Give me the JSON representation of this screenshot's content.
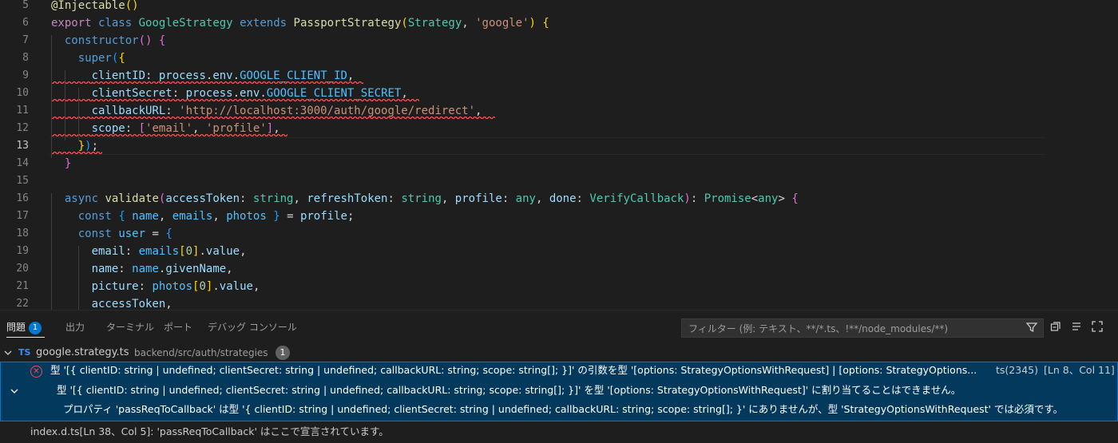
{
  "editor": {
    "lines": [
      {
        "n": "5",
        "t": [
          [
            "fn",
            "@Injectable"
          ],
          [
            "b1",
            "()"
          ]
        ]
      },
      {
        "n": "6",
        "t": [
          [
            "ctl",
            "export"
          ],
          [
            "p",
            " "
          ],
          [
            "kw",
            "class"
          ],
          [
            "p",
            " "
          ],
          [
            "cls",
            "GoogleStrategy"
          ],
          [
            "p",
            " "
          ],
          [
            "kw",
            "extends"
          ],
          [
            "p",
            " "
          ],
          [
            "fn",
            "PassportStrategy"
          ],
          [
            "b1",
            "("
          ],
          [
            "cls",
            "Strategy"
          ],
          [
            "p",
            ", "
          ],
          [
            "str",
            "'google'"
          ],
          [
            "b1",
            ")"
          ],
          [
            "p",
            " "
          ],
          [
            "b1",
            "{"
          ]
        ]
      },
      {
        "n": "7",
        "t": [
          [
            "p",
            "  "
          ],
          [
            "kw",
            "constructor"
          ],
          [
            "b2",
            "()"
          ],
          [
            "p",
            " "
          ],
          [
            "b2",
            "{"
          ]
        ]
      },
      {
        "n": "8",
        "t": [
          [
            "p",
            "    "
          ],
          [
            "kw",
            "super"
          ],
          [
            "b3",
            "("
          ],
          [
            "b1",
            "{"
          ]
        ]
      },
      {
        "n": "9",
        "t": [
          [
            "p",
            "      "
          ],
          [
            "var",
            "clientID"
          ],
          [
            "p",
            ": "
          ],
          [
            "var",
            "process"
          ],
          [
            "p",
            "."
          ],
          [
            "var",
            "env"
          ],
          [
            "p",
            "."
          ],
          [
            "const",
            "GOOGLE_CLIENT_ID"
          ],
          [
            "p",
            ","
          ]
        ]
      },
      {
        "n": "10",
        "t": [
          [
            "p",
            "      "
          ],
          [
            "var",
            "clientSecret"
          ],
          [
            "p",
            ": "
          ],
          [
            "var",
            "process"
          ],
          [
            "p",
            "."
          ],
          [
            "var",
            "env"
          ],
          [
            "p",
            "."
          ],
          [
            "const",
            "GOOGLE_CLIENT_SECRET"
          ],
          [
            "p",
            ","
          ]
        ]
      },
      {
        "n": "11",
        "t": [
          [
            "p",
            "      "
          ],
          [
            "var",
            "callbackURL"
          ],
          [
            "p",
            ": "
          ],
          [
            "str",
            "'http://localhost:3000/auth/google/redirect'"
          ],
          [
            "p",
            ","
          ]
        ]
      },
      {
        "n": "12",
        "t": [
          [
            "p",
            "      "
          ],
          [
            "var",
            "scope"
          ],
          [
            "p",
            ": "
          ],
          [
            "b2",
            "["
          ],
          [
            "str",
            "'email'"
          ],
          [
            "p",
            ", "
          ],
          [
            "str",
            "'profile'"
          ],
          [
            "b2",
            "]"
          ],
          [
            "p",
            ","
          ]
        ]
      },
      {
        "n": "13",
        "t": [
          [
            "p",
            "    "
          ],
          [
            "b1",
            "}"
          ],
          [
            "b3",
            ")"
          ],
          [
            "p",
            ";"
          ]
        ]
      },
      {
        "n": "14",
        "t": [
          [
            "p",
            "  "
          ],
          [
            "b2",
            "}"
          ]
        ]
      },
      {
        "n": "15",
        "t": []
      },
      {
        "n": "16",
        "t": [
          [
            "p",
            "  "
          ],
          [
            "kw",
            "async"
          ],
          [
            "p",
            " "
          ],
          [
            "fn",
            "validate"
          ],
          [
            "b2",
            "("
          ],
          [
            "var",
            "accessToken"
          ],
          [
            "p",
            ": "
          ],
          [
            "cls",
            "string"
          ],
          [
            "p",
            ", "
          ],
          [
            "var",
            "refreshToken"
          ],
          [
            "p",
            ": "
          ],
          [
            "cls",
            "string"
          ],
          [
            "p",
            ", "
          ],
          [
            "var",
            "profile"
          ],
          [
            "p",
            ": "
          ],
          [
            "cls",
            "any"
          ],
          [
            "p",
            ", "
          ],
          [
            "var",
            "done"
          ],
          [
            "p",
            ": "
          ],
          [
            "cls",
            "VerifyCallback"
          ],
          [
            "b2",
            ")"
          ],
          [
            "p",
            ": "
          ],
          [
            "cls",
            "Promise"
          ],
          [
            "p",
            "<"
          ],
          [
            "cls",
            "any"
          ],
          [
            "p",
            "> "
          ],
          [
            "b2",
            "{"
          ]
        ]
      },
      {
        "n": "17",
        "t": [
          [
            "p",
            "    "
          ],
          [
            "kw",
            "const"
          ],
          [
            "p",
            " "
          ],
          [
            "b3",
            "{"
          ],
          [
            "p",
            " "
          ],
          [
            "const",
            "name"
          ],
          [
            "p",
            ", "
          ],
          [
            "const",
            "emails"
          ],
          [
            "p",
            ", "
          ],
          [
            "const",
            "photos"
          ],
          [
            "p",
            " "
          ],
          [
            "b3",
            "}"
          ],
          [
            "p",
            " = "
          ],
          [
            "var",
            "profile"
          ],
          [
            "p",
            ";"
          ]
        ]
      },
      {
        "n": "18",
        "t": [
          [
            "p",
            "    "
          ],
          [
            "kw",
            "const"
          ],
          [
            "p",
            " "
          ],
          [
            "const",
            "user"
          ],
          [
            "p",
            " = "
          ],
          [
            "b3",
            "{"
          ]
        ]
      },
      {
        "n": "19",
        "t": [
          [
            "p",
            "      "
          ],
          [
            "var",
            "email"
          ],
          [
            "p",
            ": "
          ],
          [
            "const",
            "emails"
          ],
          [
            "b1",
            "["
          ],
          [
            "num",
            "0"
          ],
          [
            "b1",
            "]"
          ],
          [
            "p",
            "."
          ],
          [
            "var",
            "value"
          ],
          [
            "p",
            ","
          ]
        ]
      },
      {
        "n": "20",
        "t": [
          [
            "p",
            "      "
          ],
          [
            "var",
            "name"
          ],
          [
            "p",
            ": "
          ],
          [
            "const",
            "name"
          ],
          [
            "p",
            "."
          ],
          [
            "var",
            "givenName"
          ],
          [
            "p",
            ","
          ]
        ]
      },
      {
        "n": "21",
        "t": [
          [
            "p",
            "      "
          ],
          [
            "var",
            "picture"
          ],
          [
            "p",
            ": "
          ],
          [
            "const",
            "photos"
          ],
          [
            "b1",
            "["
          ],
          [
            "num",
            "0"
          ],
          [
            "b1",
            "]"
          ],
          [
            "p",
            "."
          ],
          [
            "var",
            "value"
          ],
          [
            "p",
            ","
          ]
        ]
      },
      {
        "n": "22",
        "t": [
          [
            "p",
            "      "
          ],
          [
            "var",
            "accessToken"
          ],
          [
            "p",
            ","
          ]
        ]
      }
    ]
  },
  "panel": {
    "tabs": {
      "problems": "問題",
      "problems_count": "1",
      "output": "出力",
      "terminal": "ターミナル",
      "ports": "ポート",
      "debug_console": "デバッグ コンソール"
    },
    "filter_placeholder": "フィルター (例: テキスト、**/*.ts、!**/node_modules/**)",
    "file": {
      "lang": "TS",
      "name": "google.strategy.ts",
      "path": "backend/src/auth/strategies",
      "count": "1"
    },
    "problem": {
      "line1": "型 '[{ clientID: string | undefined; clientSecret: string | undefined; callbackURL: string; scope: string[]; }]' の引数を型 '[options: StrategyOptionsWithRequest] | [options: StrategyOptions...",
      "code": "ts(2345)",
      "location": "[Ln 8、Col 11]",
      "line2": "型 '[{ clientID: string | undefined; clientSecret: string | undefined; callbackURL: string; scope: string[]; }]' を型 '[options: StrategyOptionsWithRequest]' に割り当てることはできません。",
      "line3": "プロパティ 'passReqToCallback' は型 '{ clientID: string | undefined; clientSecret: string | undefined; callbackURL: string; scope: string[]; }' にありませんが、型 'StrategyOptionsWithRequest' では必須です。"
    },
    "related": "index.d.ts[Ln 38、Col 5]: 'passReqToCallback' はここで宣言されています。"
  }
}
